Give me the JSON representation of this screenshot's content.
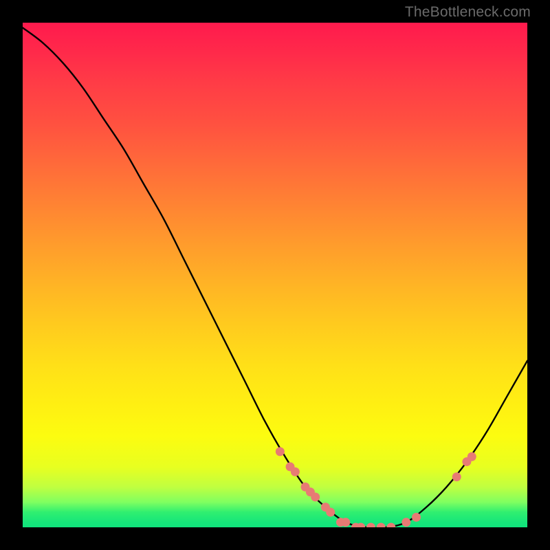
{
  "watermark": "TheBottleneck.com",
  "chart_data": {
    "type": "line",
    "title": "",
    "xlabel": "",
    "ylabel": "",
    "xlim": [
      0,
      100
    ],
    "ylim": [
      0,
      100
    ],
    "series": [
      {
        "name": "curve",
        "x": [
          0,
          4,
          8,
          12,
          16,
          20,
          24,
          28,
          32,
          36,
          40,
          44,
          48,
          52,
          56,
          60,
          64,
          68,
          72,
          76,
          80,
          84,
          88,
          92,
          96,
          100
        ],
        "y": [
          99,
          96,
          92,
          87,
          81,
          75,
          68,
          61,
          53,
          45,
          37,
          29,
          21,
          14,
          8,
          4,
          1,
          0,
          0,
          1,
          4,
          8,
          13,
          19,
          26,
          33
        ]
      }
    ],
    "markers": [
      {
        "x": 51,
        "y": 15
      },
      {
        "x": 53,
        "y": 12
      },
      {
        "x": 54,
        "y": 11
      },
      {
        "x": 56,
        "y": 8
      },
      {
        "x": 57,
        "y": 7
      },
      {
        "x": 58,
        "y": 6
      },
      {
        "x": 60,
        "y": 4
      },
      {
        "x": 61,
        "y": 3
      },
      {
        "x": 63,
        "y": 1
      },
      {
        "x": 64,
        "y": 1
      },
      {
        "x": 66,
        "y": 0
      },
      {
        "x": 67,
        "y": 0
      },
      {
        "x": 69,
        "y": 0
      },
      {
        "x": 71,
        "y": 0
      },
      {
        "x": 73,
        "y": 0
      },
      {
        "x": 76,
        "y": 1
      },
      {
        "x": 78,
        "y": 2
      },
      {
        "x": 86,
        "y": 10
      },
      {
        "x": 88,
        "y": 13
      },
      {
        "x": 89,
        "y": 14
      }
    ],
    "background_gradient": {
      "direction": "vertical",
      "stops": [
        {
          "pos": 0.0,
          "color": "#ff1a4d"
        },
        {
          "pos": 0.5,
          "color": "#ffc020"
        },
        {
          "pos": 0.85,
          "color": "#fcfc10"
        },
        {
          "pos": 1.0,
          "color": "#10e37c"
        }
      ]
    }
  }
}
